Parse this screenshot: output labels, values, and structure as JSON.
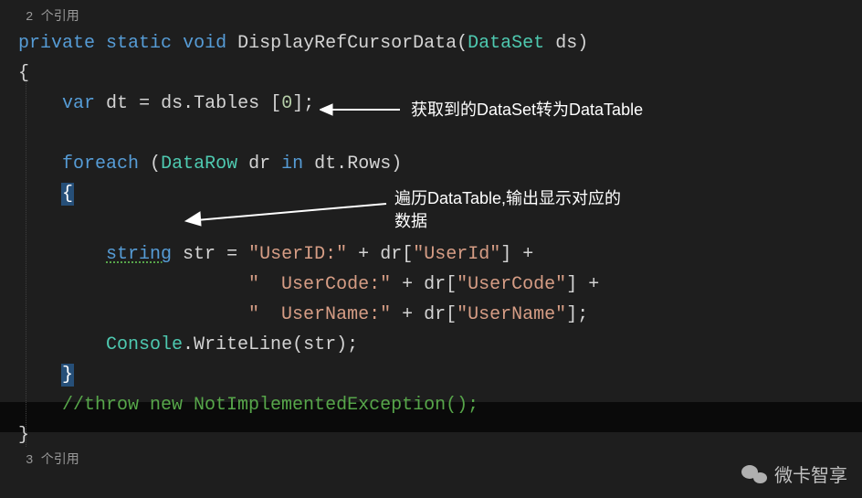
{
  "codelens": {
    "top": "2 个引用",
    "bottom": "3 个引用"
  },
  "code": {
    "modifiers": {
      "private": "private",
      "static": "static",
      "void": "void"
    },
    "method_name": "DisplayRefCursorData",
    "param_type": "DataSet",
    "param_name": "ds",
    "var_kw": "var",
    "dt": "dt",
    "eq": "=",
    "ds": "ds",
    "dot": ".",
    "tables": "Tables",
    "idx": "0",
    "semicolon": ";",
    "foreach": "foreach",
    "datarow": "DataRow",
    "dr": "dr",
    "in": "in",
    "rows": "Rows",
    "string_type": "string",
    "str_var": "str",
    "str_userid": "\"UserID:\"",
    "plus": "+",
    "col_userid": "\"UserId\"",
    "str_usercode": "\"  UserCode:\"",
    "col_usercode": "\"UserCode\"",
    "str_username": "\"  UserName:\"",
    "col_username": "\"UserName\"",
    "console": "Console",
    "writeline": "WriteLine",
    "comment_line": "//throw new NotImplementedException();"
  },
  "annotations": {
    "a1": "获取到的DataSet转为DataTable",
    "a2_l1": "遍历DataTable,输出显示对应的",
    "a2_l2": "数据"
  },
  "watermark": "微卡智享"
}
